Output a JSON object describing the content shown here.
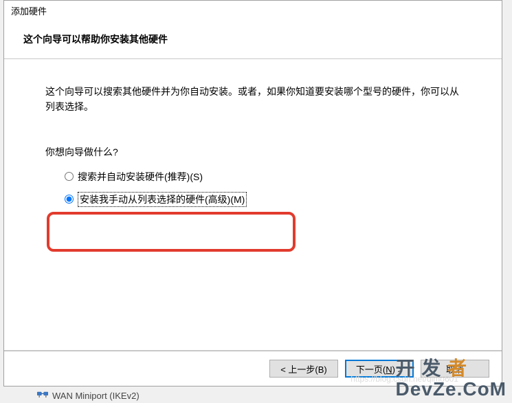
{
  "dialog": {
    "title": "添加硬件",
    "heading": "这个向导可以帮助你安装其他硬件",
    "description": "这个向导可以搜索其他硬件并为你自动安装。或者，如果你知道要安装哪个型号的硬件，你可以从列表选择。",
    "prompt": "你想向导做什么?",
    "options": {
      "auto": "搜索并自动安装硬件(推荐)(S)",
      "manual": "安装我手动从列表选择的硬件(高级)(M)"
    },
    "selected": "manual"
  },
  "buttons": {
    "back": "< 上一步(B)",
    "next_prefix": "下一页(",
    "next_key": "N",
    "next_suffix": ") >",
    "cancel": "取消"
  },
  "background": {
    "item_label": "WAN Miniport (IKEv2)"
  },
  "watermark": {
    "url": "https://blog.csdn.net/qimo601",
    "line1_a": "开",
    "line1_b": "发",
    "line1_c": "者",
    "line2": "DevZe.CoM"
  }
}
